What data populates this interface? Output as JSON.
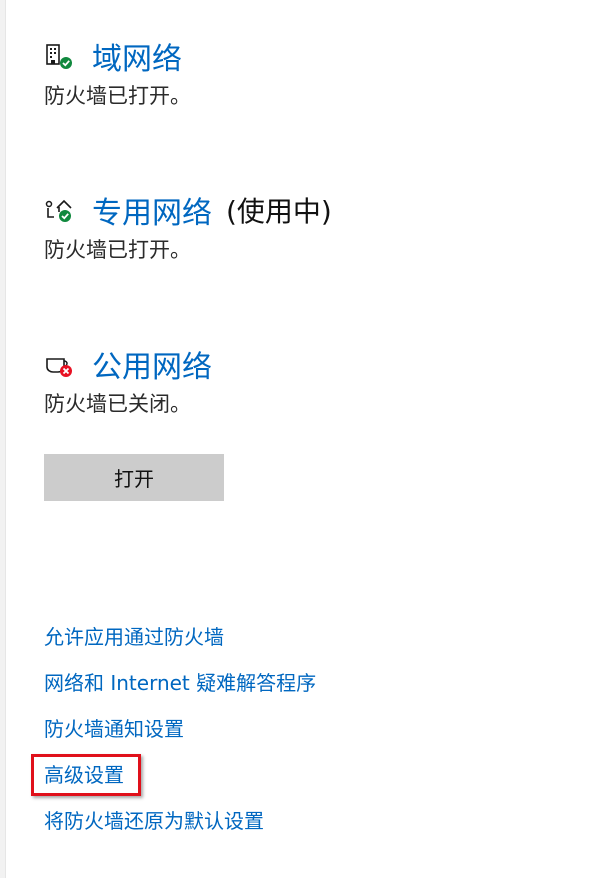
{
  "networks": [
    {
      "title": "域网络",
      "suffix": "",
      "status": "防火墙已打开。",
      "icon": "domain-network-icon",
      "badge": "ok"
    },
    {
      "title": "专用网络",
      "suffix": "(使用中)",
      "status": "防火墙已打开。",
      "icon": "private-network-icon",
      "badge": "ok"
    },
    {
      "title": "公用网络",
      "suffix": "",
      "status": "防火墙已关闭。",
      "icon": "public-network-icon",
      "badge": "error"
    }
  ],
  "turn_on_button": {
    "label": "打开"
  },
  "links": [
    {
      "label": "允许应用通过防火墙"
    },
    {
      "label": "网络和 Internet 疑难解答程序"
    },
    {
      "label": "防火墙通知设置"
    },
    {
      "label": "高级设置",
      "highlighted": true
    },
    {
      "label": "将防火墙还原为默认设置"
    }
  ],
  "colors": {
    "link": "#0067c0",
    "ok_badge": "#10893e",
    "error_badge": "#e81123",
    "highlight": "#e0101a",
    "button_bg": "#cccccc"
  }
}
